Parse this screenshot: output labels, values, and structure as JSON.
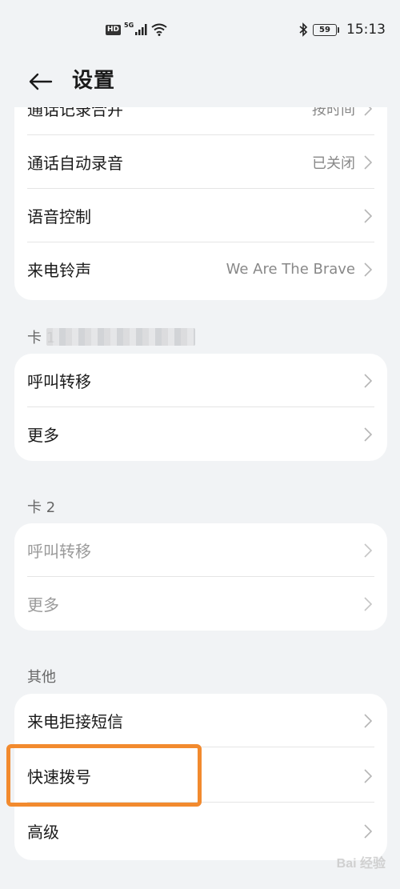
{
  "status_bar": {
    "hd": "HD",
    "network": "5G",
    "battery": "59",
    "time": "15:13"
  },
  "header": {
    "title": "设置"
  },
  "groups": {
    "top": {
      "rows": [
        {
          "label": "通话记录合并",
          "value": "按时间"
        },
        {
          "label": "通话自动录音",
          "value": "已关闭"
        },
        {
          "label": "语音控制",
          "value": ""
        },
        {
          "label": "来电铃声",
          "value": "We Are The Brave"
        }
      ]
    },
    "card1": {
      "section_label": "卡 1",
      "rows": [
        {
          "label": "呼叫转移"
        },
        {
          "label": "更多"
        }
      ]
    },
    "card2": {
      "section_label": "卡 2",
      "rows": [
        {
          "label": "呼叫转移"
        },
        {
          "label": "更多"
        }
      ]
    },
    "other": {
      "section_label": "其他",
      "rows": [
        {
          "label": "来电拒接短信"
        },
        {
          "label": "快速拨号"
        },
        {
          "label": "高级"
        }
      ]
    }
  },
  "watermark": "Bai 经验",
  "colors": {
    "background": "#f1f3f5",
    "card": "#ffffff",
    "highlight": "#f28a2e",
    "disabled_text": "#9a9a9a"
  }
}
